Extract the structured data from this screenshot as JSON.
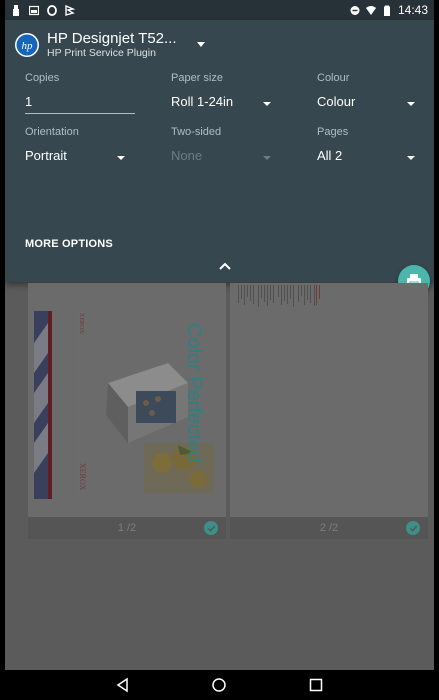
{
  "status_bar": {
    "time": "14:43"
  },
  "printer": {
    "name": "HP Designjet T52...",
    "subtitle": "HP Print Service Plugin"
  },
  "fields": {
    "copies": {
      "label": "Copies",
      "value": "1"
    },
    "paper_size": {
      "label": "Paper size",
      "value": "Roll 1-24in"
    },
    "colour": {
      "label": "Colour",
      "value": "Colour"
    },
    "orientation": {
      "label": "Orientation",
      "value": "Portrait"
    },
    "two_sided": {
      "label": "Two-sided",
      "value": "None"
    },
    "pages": {
      "label": "Pages",
      "value": "All 2"
    }
  },
  "more_options_label": "MORE OPTIONS",
  "preview": {
    "page1_label": "1 /2",
    "page2_label": "2 /2",
    "page1_brand": "XEROX",
    "page1_tagline": "Color Perfected"
  },
  "colors": {
    "panel": "#37474f",
    "accent": "#4db6ac",
    "status_bar": "#263238"
  },
  "icons": {
    "fab": "print-icon",
    "logo": "hp-logo"
  }
}
